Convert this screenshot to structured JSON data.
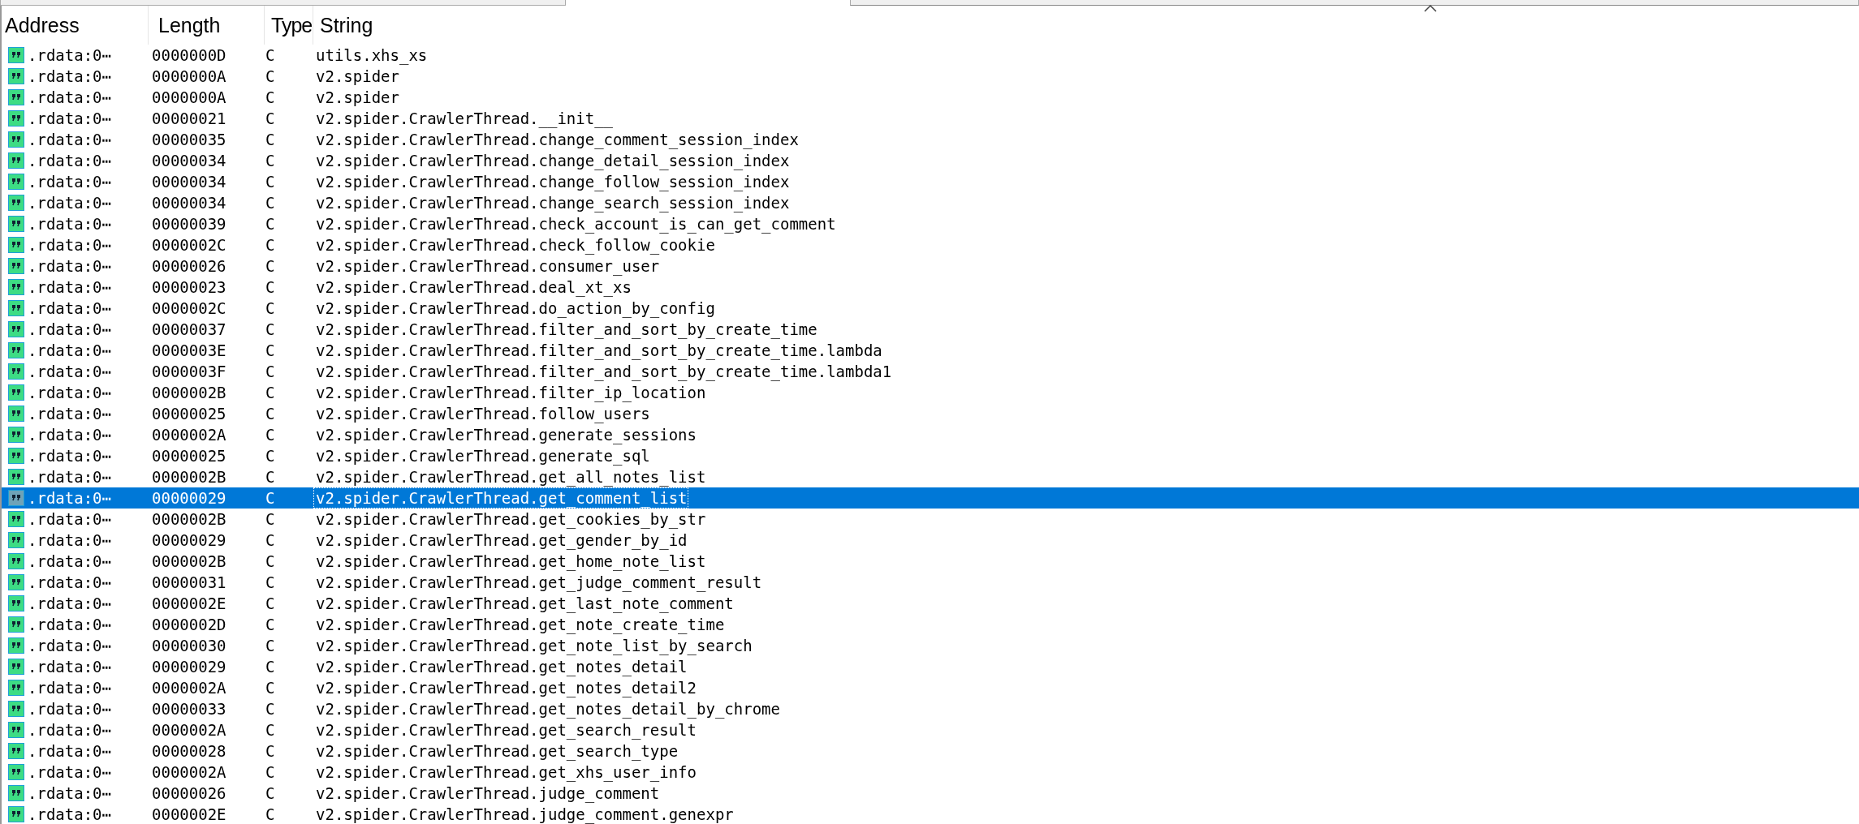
{
  "table": {
    "columns": [
      {
        "label": "Address"
      },
      {
        "label": "Length"
      },
      {
        "label": "Type"
      },
      {
        "label": "String"
      }
    ],
    "rows": [
      {
        "address": ".rdata:0⋯",
        "length": "0000000D",
        "type": "C",
        "string": "utils.xhs_xs",
        "selected": false
      },
      {
        "address": ".rdata:0⋯",
        "length": "0000000A",
        "type": "C",
        "string": "v2.spider",
        "selected": false
      },
      {
        "address": ".rdata:0⋯",
        "length": "0000000A",
        "type": "C",
        "string": "v2.spider",
        "selected": false
      },
      {
        "address": ".rdata:0⋯",
        "length": "00000021",
        "type": "C",
        "string": "v2.spider.CrawlerThread.__init__",
        "selected": false
      },
      {
        "address": ".rdata:0⋯",
        "length": "00000035",
        "type": "C",
        "string": "v2.spider.CrawlerThread.change_comment_session_index",
        "selected": false
      },
      {
        "address": ".rdata:0⋯",
        "length": "00000034",
        "type": "C",
        "string": "v2.spider.CrawlerThread.change_detail_session_index",
        "selected": false
      },
      {
        "address": ".rdata:0⋯",
        "length": "00000034",
        "type": "C",
        "string": "v2.spider.CrawlerThread.change_follow_session_index",
        "selected": false
      },
      {
        "address": ".rdata:0⋯",
        "length": "00000034",
        "type": "C",
        "string": "v2.spider.CrawlerThread.change_search_session_index",
        "selected": false
      },
      {
        "address": ".rdata:0⋯",
        "length": "00000039",
        "type": "C",
        "string": "v2.spider.CrawlerThread.check_account_is_can_get_comment",
        "selected": false
      },
      {
        "address": ".rdata:0⋯",
        "length": "0000002C",
        "type": "C",
        "string": "v2.spider.CrawlerThread.check_follow_cookie",
        "selected": false
      },
      {
        "address": ".rdata:0⋯",
        "length": "00000026",
        "type": "C",
        "string": "v2.spider.CrawlerThread.consumer_user",
        "selected": false
      },
      {
        "address": ".rdata:0⋯",
        "length": "00000023",
        "type": "C",
        "string": "v2.spider.CrawlerThread.deal_xt_xs",
        "selected": false
      },
      {
        "address": ".rdata:0⋯",
        "length": "0000002C",
        "type": "C",
        "string": "v2.spider.CrawlerThread.do_action_by_config",
        "selected": false
      },
      {
        "address": ".rdata:0⋯",
        "length": "00000037",
        "type": "C",
        "string": "v2.spider.CrawlerThread.filter_and_sort_by_create_time",
        "selected": false
      },
      {
        "address": ".rdata:0⋯",
        "length": "0000003E",
        "type": "C",
        "string": "v2.spider.CrawlerThread.filter_and_sort_by_create_time.lambda",
        "selected": false
      },
      {
        "address": ".rdata:0⋯",
        "length": "0000003F",
        "type": "C",
        "string": "v2.spider.CrawlerThread.filter_and_sort_by_create_time.lambda1",
        "selected": false
      },
      {
        "address": ".rdata:0⋯",
        "length": "0000002B",
        "type": "C",
        "string": "v2.spider.CrawlerThread.filter_ip_location",
        "selected": false
      },
      {
        "address": ".rdata:0⋯",
        "length": "00000025",
        "type": "C",
        "string": "v2.spider.CrawlerThread.follow_users",
        "selected": false
      },
      {
        "address": ".rdata:0⋯",
        "length": "0000002A",
        "type": "C",
        "string": "v2.spider.CrawlerThread.generate_sessions",
        "selected": false
      },
      {
        "address": ".rdata:0⋯",
        "length": "00000025",
        "type": "C",
        "string": "v2.spider.CrawlerThread.generate_sql",
        "selected": false
      },
      {
        "address": ".rdata:0⋯",
        "length": "0000002B",
        "type": "C",
        "string": "v2.spider.CrawlerThread.get_all_notes_list",
        "selected": false
      },
      {
        "address": ".rdata:0⋯",
        "length": "00000029",
        "type": "C",
        "string": "v2.spider.CrawlerThread.get_comment_list",
        "selected": true
      },
      {
        "address": ".rdata:0⋯",
        "length": "0000002B",
        "type": "C",
        "string": "v2.spider.CrawlerThread.get_cookies_by_str",
        "selected": false
      },
      {
        "address": ".rdata:0⋯",
        "length": "00000029",
        "type": "C",
        "string": "v2.spider.CrawlerThread.get_gender_by_id",
        "selected": false
      },
      {
        "address": ".rdata:0⋯",
        "length": "0000002B",
        "type": "C",
        "string": "v2.spider.CrawlerThread.get_home_note_list",
        "selected": false
      },
      {
        "address": ".rdata:0⋯",
        "length": "00000031",
        "type": "C",
        "string": "v2.spider.CrawlerThread.get_judge_comment_result",
        "selected": false
      },
      {
        "address": ".rdata:0⋯",
        "length": "0000002E",
        "type": "C",
        "string": "v2.spider.CrawlerThread.get_last_note_comment",
        "selected": false
      },
      {
        "address": ".rdata:0⋯",
        "length": "0000002D",
        "type": "C",
        "string": "v2.spider.CrawlerThread.get_note_create_time",
        "selected": false
      },
      {
        "address": ".rdata:0⋯",
        "length": "00000030",
        "type": "C",
        "string": "v2.spider.CrawlerThread.get_note_list_by_search",
        "selected": false
      },
      {
        "address": ".rdata:0⋯",
        "length": "00000029",
        "type": "C",
        "string": "v2.spider.CrawlerThread.get_notes_detail",
        "selected": false
      },
      {
        "address": ".rdata:0⋯",
        "length": "0000002A",
        "type": "C",
        "string": "v2.spider.CrawlerThread.get_notes_detail2",
        "selected": false
      },
      {
        "address": ".rdata:0⋯",
        "length": "00000033",
        "type": "C",
        "string": "v2.spider.CrawlerThread.get_notes_detail_by_chrome",
        "selected": false
      },
      {
        "address": ".rdata:0⋯",
        "length": "0000002A",
        "type": "C",
        "string": "v2.spider.CrawlerThread.get_search_result",
        "selected": false
      },
      {
        "address": ".rdata:0⋯",
        "length": "00000028",
        "type": "C",
        "string": "v2.spider.CrawlerThread.get_search_type",
        "selected": false
      },
      {
        "address": ".rdata:0⋯",
        "length": "0000002A",
        "type": "C",
        "string": "v2.spider.CrawlerThread.get_xhs_user_info",
        "selected": false
      },
      {
        "address": ".rdata:0⋯",
        "length": "00000026",
        "type": "C",
        "string": "v2.spider.CrawlerThread.judge_comment",
        "selected": false
      },
      {
        "address": ".rdata:0⋯",
        "length": "0000002E",
        "type": "C",
        "string": "v2.spider.CrawlerThread.judge_comment.genexpr",
        "selected": false
      }
    ]
  }
}
